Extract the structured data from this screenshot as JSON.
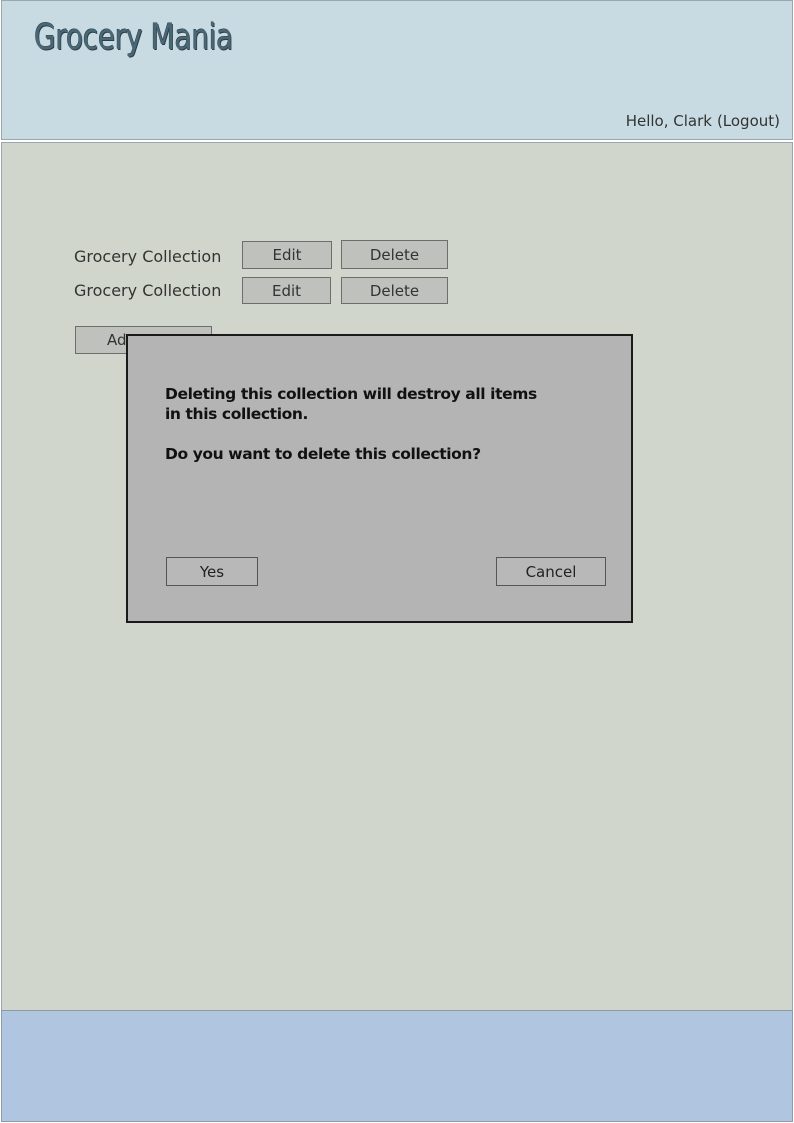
{
  "header": {
    "logo": "Grocery Mania",
    "greeting": "Hello, Clark",
    "logout_label": "(Logout)"
  },
  "collections": [
    {
      "label": "Grocery Collection",
      "edit_label": "Edit",
      "delete_label": "Delete"
    },
    {
      "label": "Grocery Collection",
      "edit_label": "Edit",
      "delete_label": "Delete"
    }
  ],
  "add_button_label": "Ad",
  "dialog": {
    "message_line1": "Deleting this collection will destroy all items",
    "message_line2": "in this collection.",
    "question": "Do you want to delete this collection?",
    "yes_label": "Yes",
    "cancel_label": "Cancel"
  },
  "colors": {
    "header_bg": "#c8dbe2",
    "main_bg": "#d1d6cc",
    "footer_bg": "#b0c5e0",
    "dialog_bg": "#b4b4b4"
  }
}
